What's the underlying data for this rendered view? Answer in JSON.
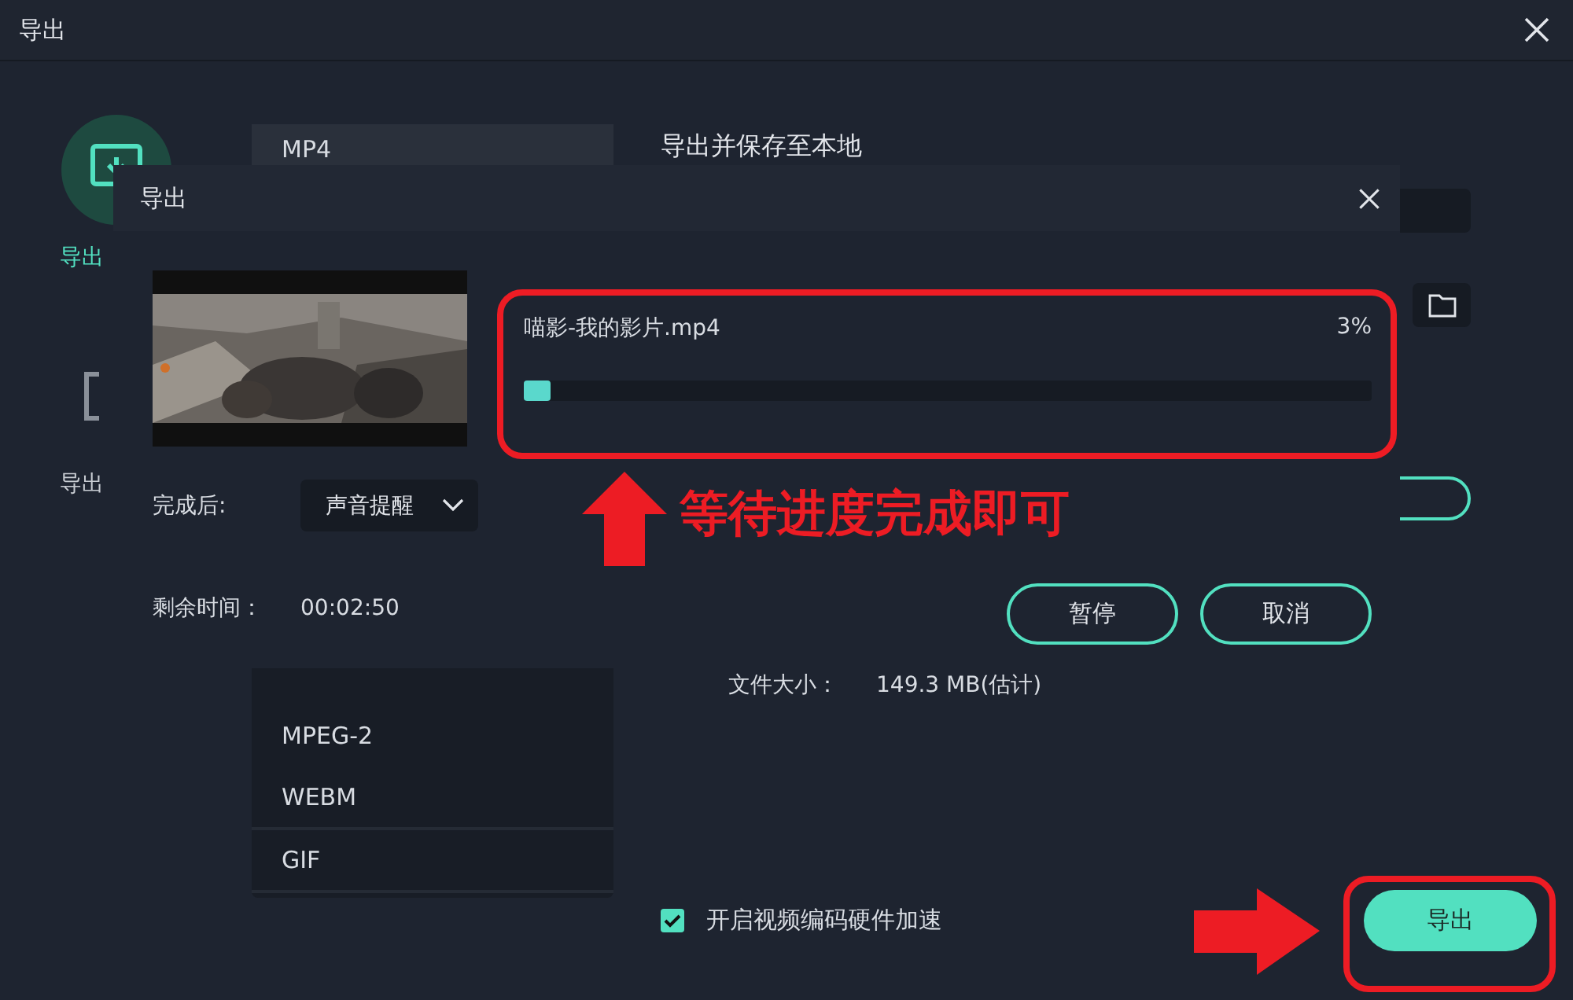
{
  "window": {
    "title": "导出"
  },
  "sidebar": {
    "items": [
      {
        "label": "导出",
        "selected": true
      },
      {
        "label": "导出",
        "selected": false
      }
    ]
  },
  "formats": [
    {
      "label": "MP4",
      "selected": true
    },
    {
      "label": "MPEG-2",
      "selected": false
    },
    {
      "label": "WEBM",
      "selected": false
    },
    {
      "label": "GIF",
      "selected": false
    }
  ],
  "export_heading": "导出并保存至本地",
  "file_size": {
    "label": "文件大小：",
    "value": "149.3 MB(估计)"
  },
  "hardware_acceleration": {
    "label": "开启视频编码硬件加速",
    "checked": true
  },
  "export_button": "导出",
  "progress_dialog": {
    "title": "导出",
    "file_name": "喵影-我的影片.mp4",
    "percent": "3%",
    "level": 0.03,
    "after_label": "完成后:",
    "after_value": "声音提醒",
    "remaining_label": "剩余时间：",
    "remaining_value": "00:02:50",
    "buttons": [
      "暂停",
      "取消"
    ]
  },
  "annotation": {
    "text": "等待进度完成即可"
  }
}
